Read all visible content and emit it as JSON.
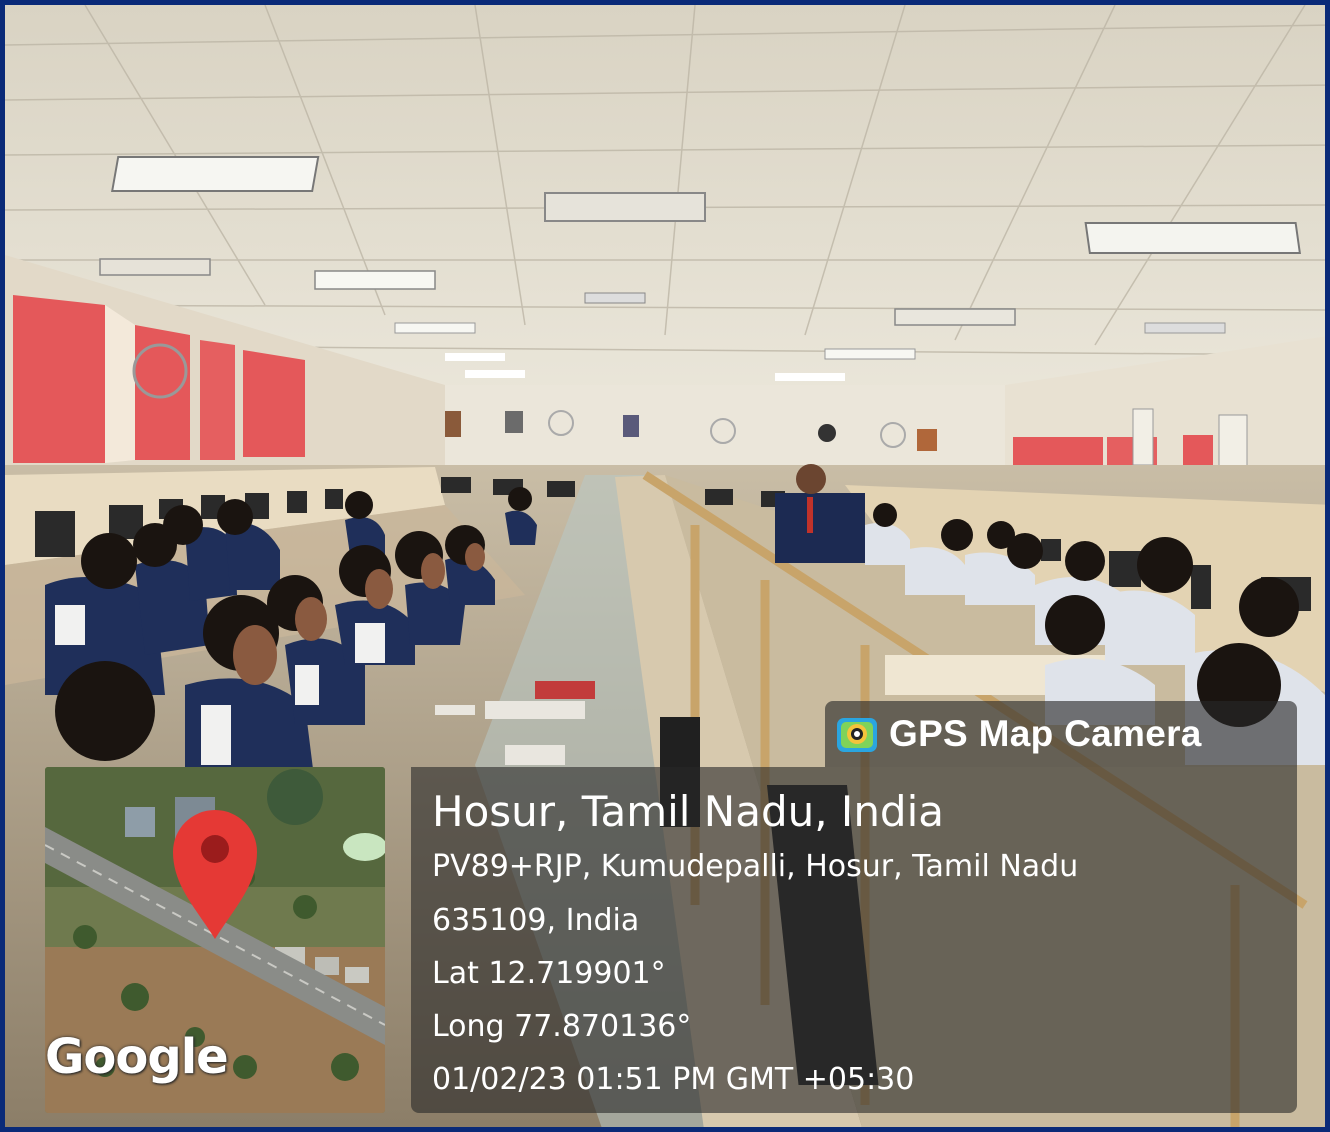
{
  "overlay": {
    "app_name": "GPS Map Camera",
    "location_title": "Hosur, Tamil Nadu, India",
    "address_line1": "PV89+RJP, Kumudepalli, Hosur, Tamil Nadu",
    "address_line2": "635109, India",
    "latitude": "Lat 12.719901°",
    "longitude": "Long 77.870136°",
    "datetime": "01/02/23 01:51 PM GMT +05:30"
  },
  "map": {
    "logo_text": "Google",
    "pin_color": "#e53935"
  },
  "colors": {
    "frame_border": "#0a2a78",
    "curtain": "#e4585a",
    "uniform": "#1f2f5a"
  }
}
